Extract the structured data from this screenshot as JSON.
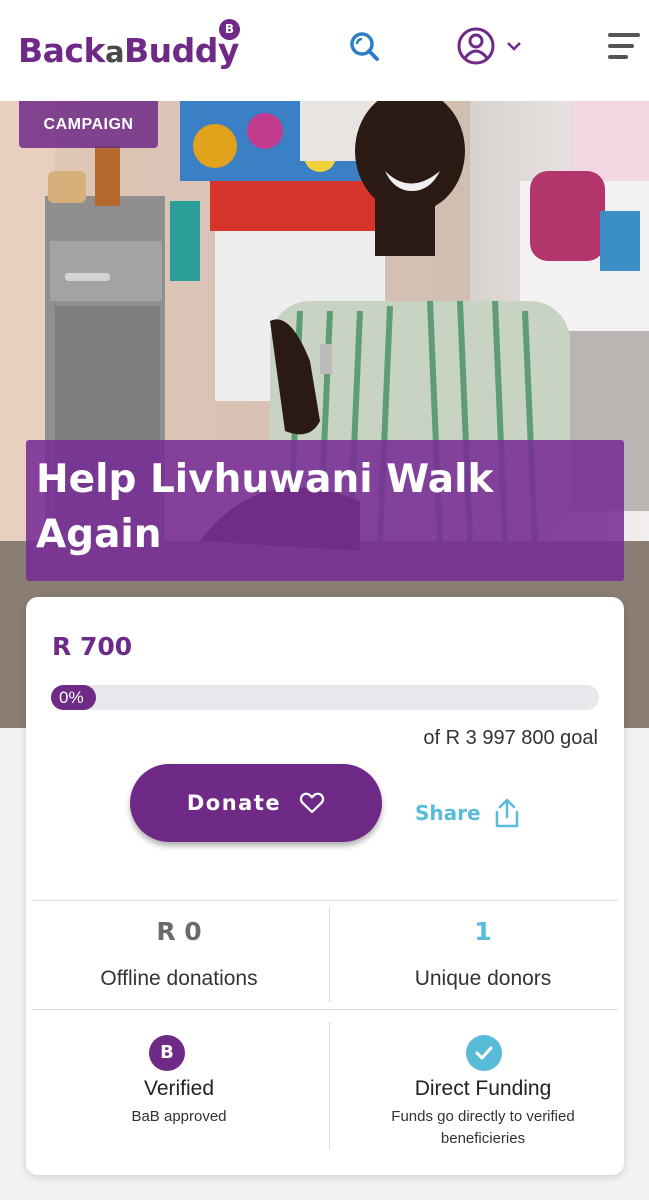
{
  "header": {
    "logo_main": "Back",
    "logo_a": "a",
    "logo_end": "Buddy",
    "logo_badge": "B",
    "icons": [
      "search-icon",
      "user-account-icon",
      "chevron-down-icon",
      "hamburger-menu-icon"
    ]
  },
  "hero": {
    "badge": "CAMPAIGN",
    "title": "Help Livhuwani Walk Again"
  },
  "campaign": {
    "raised": "R 700",
    "progress_percent": 0,
    "progress_label": "0%",
    "goal_text": "of R 3 997 800 goal",
    "donate_label": "Donate",
    "share_label": "Share"
  },
  "stats": {
    "offline_value": "R 0",
    "offline_label": "Offline donations",
    "donors_value": "1",
    "donors_label": "Unique donors"
  },
  "features": {
    "verified_badge": "B",
    "verified_title": "Verified",
    "verified_desc": "BaB approved",
    "direct_title": "Direct Funding",
    "direct_desc": "Funds go directly to verified beneficieries"
  },
  "colors": {
    "brand_purple": "#6f2a87",
    "accent_blue": "#58bcd9",
    "search_blue": "#2a7fc9"
  }
}
